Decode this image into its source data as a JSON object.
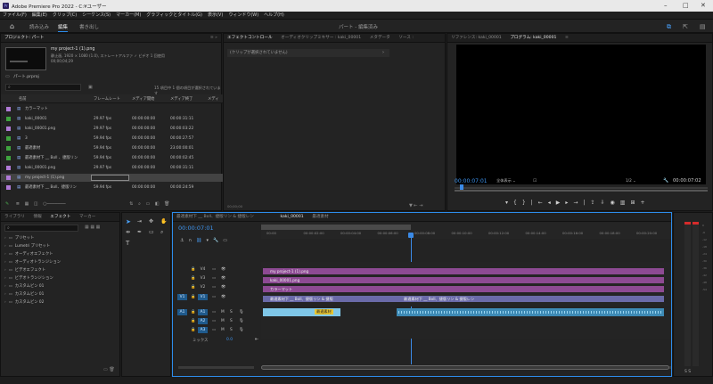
{
  "window": {
    "title": "Adobe Premiere Pro 2022 - C:¥ユーザー"
  },
  "menu": [
    "ファイル(F)",
    "編集(E)",
    "クリップ(C)",
    "シーケンス(S)",
    "マーカー(M)",
    "グラフィックとタイトル(G)",
    "表示(V)",
    "ウィンドウ(W)",
    "ヘルプ(H)"
  ],
  "workspace": {
    "tabs": [
      "読み込み",
      "編集",
      "書き出し"
    ],
    "active": 1,
    "center_label": "パート - 編集済み"
  },
  "project": {
    "tabs": [
      "プロジェクト: パート"
    ],
    "preview_name": "my project-1 (1).png",
    "preview_info": "静止画, 1920 × 1080 (1.0), ストレートアルファ ✓ ビデオ 1 回使用",
    "preview_duration": "00;00;04;29",
    "project_file": "パート.prproj",
    "selection_info": "15 項目中 1 個の項目が選択されています",
    "columns": [
      "名前",
      "フレームレート",
      "メディア開始",
      "メディア終了",
      "メディ"
    ],
    "items": [
      {
        "name": "カラーマット",
        "fps": "",
        "start": "",
        "end": "",
        "color": "#b07ad6"
      },
      {
        "name": "kaki_00001",
        "fps": "29.97 fps",
        "start": "00:00:00:00",
        "end": "00:00:31:11",
        "color": "#3fa33f"
      },
      {
        "name": "kaki_00001.png",
        "fps": "29.97 fps",
        "start": "00:00:00:00",
        "end": "00:00:03:22",
        "color": "#b07ad6"
      },
      {
        "name": "3",
        "fps": "59.94 fps",
        "start": "00:00:00:00",
        "end": "00:00:27:57",
        "color": "#3fa33f"
      },
      {
        "name": "最適素材",
        "fps": "59.94 fps",
        "start": "00:00:00:00",
        "end": "23:00:00:01",
        "color": "#3fa33f"
      },
      {
        "name": "最適素材下 __ Boll 、捷版リン",
        "fps": "59.94 fps",
        "start": "00:00:00:00",
        "end": "00:00:02:45",
        "color": "#3fa33f"
      },
      {
        "name": "kaki_00001.png",
        "fps": "29.97 fps",
        "start": "00:00:00:00",
        "end": "00:00:31:11",
        "color": "#b07ad6"
      },
      {
        "name": "my project-1 (1).png",
        "fps": "",
        "start": "",
        "end": "",
        "color": "#b07ad6",
        "selected": true
      },
      {
        "name": "最適素材下 __ Boll、捷版リン",
        "fps": "59.94 fps",
        "start": "00:00:00:00",
        "end": "00:00:24:59",
        "color": "#b07ad6"
      }
    ]
  },
  "effect_controls": {
    "tabs": [
      "エフェクトコントロール",
      "オーディオクリップミキサー : kaki_00001",
      "メタデータ",
      "ソース :"
    ],
    "empty_text": "(クリップが選択されていません)",
    "time": "00;00;00"
  },
  "program": {
    "tabs": [
      "リファレンス: kaki_00001",
      "プログラム: kaki_00001"
    ],
    "timecode": "00:00:07:01",
    "fit": "全体表示",
    "quality": "1/2",
    "duration": "00:00:07:02"
  },
  "effects": {
    "tabs": [
      "ライブラリ",
      "情報",
      "エフェクト",
      "マーカー"
    ],
    "items": [
      "プリセット",
      "Lumetri プリセット",
      "オーディオエフェクト",
      "オーディオトランジション",
      "ビデオエフェクト",
      "ビデオトランジション",
      "カスタムビン 01",
      "カスタムビン 01",
      "カスタムビン 02"
    ]
  },
  "timeline": {
    "tabs": [
      "最適素材下 __ Boll、捷版リン & 捷版レン",
      "kaki_00001",
      "最適素材"
    ],
    "timecode": "00:00:07:01",
    "ruler": [
      "00:00",
      "00:00:02:00",
      "00:00:04:00",
      "00:00:06:00",
      "00:00:08:00",
      "00:00:10:00",
      "00:00:12:00",
      "00:00:14:00",
      "00:00:16:00",
      "00:00:18:00",
      "00:00:20:00"
    ],
    "video_tracks": [
      "V4",
      "V3",
      "V2",
      "V1"
    ],
    "audio_tracks": [
      "A1",
      "A2",
      "A3"
    ],
    "mix_label": "ミックス",
    "mix_value": "0.0",
    "clips": {
      "v4": "my project-1 (1).png",
      "v3": "kaki_00001.png",
      "v2": "カラーマット",
      "v1a": "最適素材下 __ Boll、捷版リン & 捷版",
      "v1b": "最適素材下 __ Boll、捷版リン & 捷版レン",
      "a1": "最適素材"
    }
  },
  "colors": {
    "accent": "#2d8ceb",
    "video_clip": "#8d4a93",
    "audio_clip": "#3d8ab5",
    "playhead": "#3b8ae6"
  }
}
